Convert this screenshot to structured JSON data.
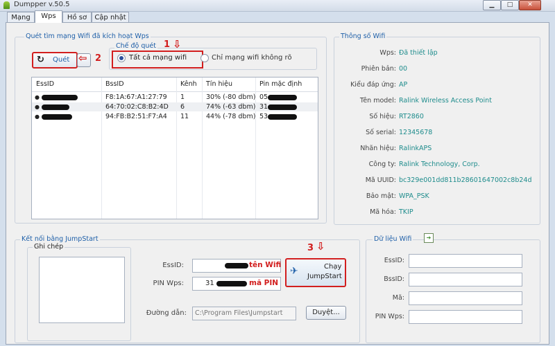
{
  "window": {
    "title": "Dumpper v.50.5",
    "minimize": "▁",
    "maximize": "□",
    "close": "✕"
  },
  "tabs": [
    {
      "label": "Mạng"
    },
    {
      "label": "Wps"
    },
    {
      "label": "Hồ sơ"
    },
    {
      "label": "Cập nhật"
    }
  ],
  "scan_group": {
    "title": "Quét tìm mạng Wifi đã kích hoạt Wps",
    "scan_button": "Quét",
    "mode_title": "Chế độ quét",
    "mode_all": "Tất cả mạng wifi",
    "mode_unknown": "Chỉ mạng wifi không rõ",
    "annotation_1": "1",
    "annotation_2": "2",
    "columns": [
      "EssID",
      "BssID",
      "Kênh",
      "Tín hiệu",
      "Pin mặc định"
    ],
    "rows": [
      {
        "essid": "",
        "bssid": "F8:1A:67:A1:27:79",
        "channel": "1",
        "signal": "30% (-80 dbm)",
        "pin": "05"
      },
      {
        "essid": "",
        "bssid": "64:70:02:C8:B2:4D",
        "channel": "6",
        "signal": "74% (-63 dbm)",
        "pin": "31"
      },
      {
        "essid": "",
        "bssid": "94:FB:B2:51:F7:A4",
        "channel": "11",
        "signal": "44% (-78 dbm)",
        "pin": "53"
      }
    ]
  },
  "wifi_info": {
    "title": "Thông số Wifi",
    "fields": [
      {
        "label": "Wps:",
        "value": "Đã thiết lập"
      },
      {
        "label": "Phiên bản:",
        "value": "00"
      },
      {
        "label": "Kiểu đáp ứng:",
        "value": "AP"
      },
      {
        "label": "Tên model:",
        "value": "Ralink Wireless Access Point"
      },
      {
        "label": "Số hiệu:",
        "value": "RT2860"
      },
      {
        "label": "Số serial:",
        "value": "12345678"
      },
      {
        "label": "Nhãn hiệu:",
        "value": "RalinkAPS"
      },
      {
        "label": "Công ty:",
        "value": "Ralink Technology, Corp."
      },
      {
        "label": "Mã UUID:",
        "value": "bc329e001dd811b28601647002c8b24d"
      },
      {
        "label": "Bảo mật:",
        "value": "WPA_PSK"
      },
      {
        "label": "Mã hóa:",
        "value": "TKIP"
      }
    ]
  },
  "jumpstart": {
    "title": "Kết nối bằng JumpStart",
    "notes_label": "Ghi chép",
    "essid_label": "EssID:",
    "essid_annotation": "tên Wifi",
    "pin_label": "PIN Wps:",
    "pin_value": "31",
    "pin_annotation": "mã PIN",
    "run_button_line1": "Chạy",
    "run_button_line2": "JumpStart",
    "annotation_3": "3",
    "path_label": "Đường dẫn:",
    "path_value": "C:\\Program Files\\Jumpstart",
    "browse_button": "Duyệt..."
  },
  "wifi_data": {
    "title": "Dữ liệu Wifi",
    "essid_label": "EssID:",
    "bssid_label": "BssID:",
    "key_label": "Mã:",
    "pin_label": "PIN Wps:"
  },
  "colors": {
    "accent": "#1e5fa8",
    "annotation": "#d21e1e",
    "value": "#1e8c8c"
  }
}
